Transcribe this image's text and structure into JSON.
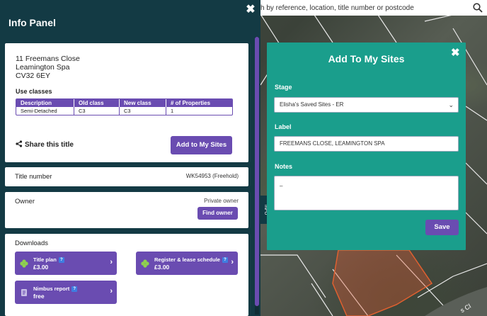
{
  "map": {
    "search_placeholder": "h by reference, location, title number or postcode",
    "side_tab_label": "INFO"
  },
  "info_panel": {
    "title": "Info Panel",
    "close_glyph": "✖",
    "address": {
      "line1": "11 Freemans Close",
      "line2": "Leamington Spa",
      "line3": "CV32 6EY"
    },
    "use_classes": {
      "title": "Use classes",
      "headers": [
        "Description",
        "Old class",
        "New class",
        "# of Properties"
      ],
      "rows": [
        [
          "Semi-Detached",
          "C3",
          "C3",
          "1"
        ]
      ]
    },
    "share_label": "Share this title",
    "add_button": "Add to My Sites",
    "title_number": {
      "label": "Title number",
      "value": "WK54953 (Freehold)"
    },
    "owner": {
      "label": "Owner",
      "value": "Private owner",
      "button": "Find owner"
    },
    "downloads": {
      "title": "Downloads",
      "items": [
        {
          "name": "Title plan",
          "price": "£3.00",
          "help": "?",
          "icon": "clover-icon"
        },
        {
          "name": "Register & lease schedule",
          "price": "£3.00",
          "help": "?",
          "icon": "clover-icon"
        },
        {
          "name": "Nimbus report",
          "price": "free",
          "help": "?",
          "icon": "document-icon"
        }
      ]
    }
  },
  "modal": {
    "title": "Add To My Sites",
    "close_glyph": "✖",
    "stage_label": "Stage",
    "stage_value": "Elisha's Saved Sites - ER",
    "label_label": "Label",
    "label_value": "FREEMANS CLOSE, LEAMINGTON SPA",
    "notes_label": "Notes",
    "notes_value": "–",
    "save_button": "Save"
  },
  "colors": {
    "panel_bg": "#133a44",
    "accent_purple": "#6a4cb1",
    "modal_teal": "#1a9e8c"
  }
}
